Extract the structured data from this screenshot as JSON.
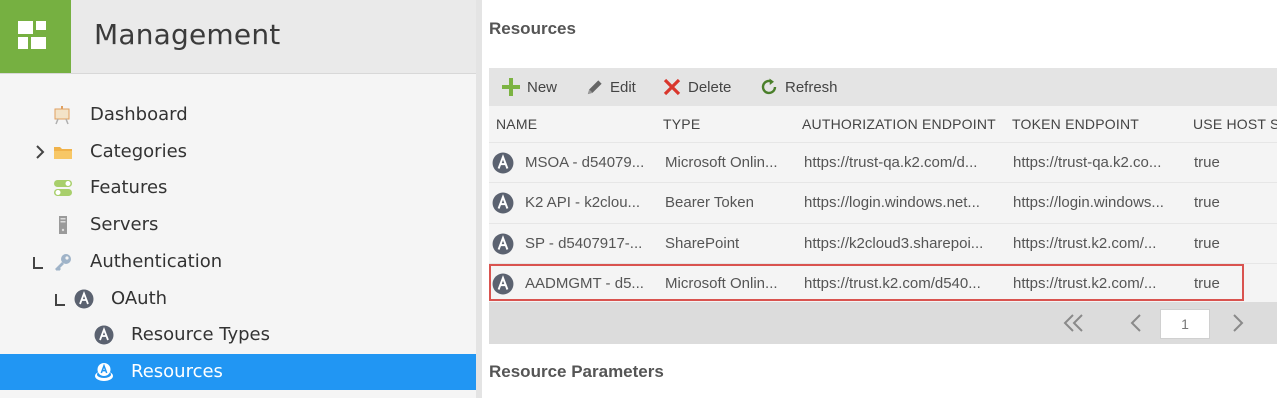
{
  "app": {
    "title": "Management"
  },
  "nav": {
    "items": [
      {
        "label": "Dashboard"
      },
      {
        "label": "Categories"
      },
      {
        "label": "Features"
      },
      {
        "label": "Servers"
      },
      {
        "label": "Authentication"
      },
      {
        "label": "OAuth"
      },
      {
        "label": "Resource Types"
      },
      {
        "label": "Resources",
        "selected": true
      }
    ]
  },
  "resources": {
    "title": "Resources",
    "toolbar": {
      "new": "New",
      "edit": "Edit",
      "delete": "Delete",
      "refresh": "Refresh"
    },
    "columns": [
      "NAME",
      "TYPE",
      "AUTHORIZATION ENDPOINT",
      "TOKEN ENDPOINT",
      "USE HOST SE"
    ],
    "rows": [
      {
        "name": "MSOA - d54079...",
        "type": "Microsoft Onlin...",
        "auth": "https://trust-qa.k2.com/d...",
        "token": "https://trust-qa.k2.co...",
        "host": "true"
      },
      {
        "name": "K2 API - k2clou...",
        "type": "Bearer Token",
        "auth": "https://login.windows.net...",
        "token": "https://login.windows...",
        "host": "true"
      },
      {
        "name": "SP - d5407917-...",
        "type": "SharePoint",
        "auth": "https://k2cloud3.sharepoi...",
        "token": "https://trust.k2.com/...",
        "host": "true"
      },
      {
        "name": "AADMGMT - d5...",
        "type": "Microsoft Onlin...",
        "auth": "https://trust.k2.com/d540...",
        "token": "https://trust.k2.com/...",
        "host": "true",
        "highlighted": true
      }
    ],
    "pager": {
      "page": "1"
    }
  },
  "params": {
    "title": "Resource Parameters"
  },
  "colors": {
    "brand": "#76b041",
    "selected": "#2196f3",
    "highlight": "#d9534f"
  }
}
